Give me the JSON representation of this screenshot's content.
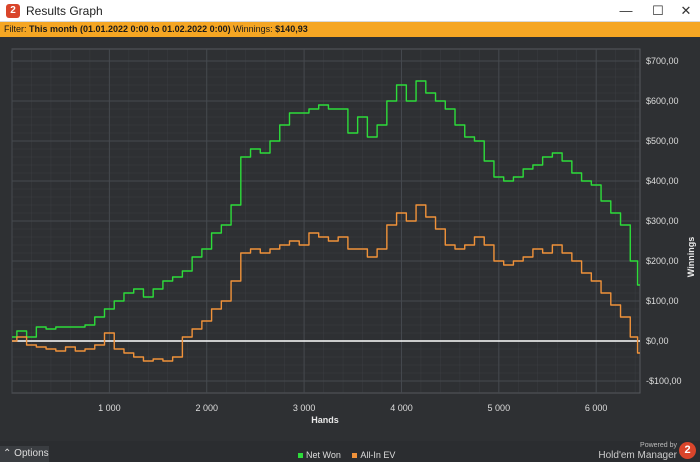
{
  "window": {
    "title": "Results Graph",
    "minimize_glyph": "—",
    "maximize_glyph": "☐",
    "close_glyph": "✕"
  },
  "filter": {
    "label": "Filter:",
    "value": "This month (01.01.2022 0:00 to 01.02.2022 0:00)",
    "winnings_label": "Winnings:",
    "winnings_value": "$140,93"
  },
  "footer": {
    "options_label": "Options",
    "powered_by": "Powered by",
    "product": "Hold'em Manager",
    "logo_text": "2"
  },
  "colors": {
    "background": "#2e3033",
    "net_won": "#2ddc3a",
    "all_in_ev": "#f0923a",
    "zero_line": "#ffffff",
    "grid": "#464a4f"
  },
  "chart_data": {
    "type": "line",
    "xlabel": "Hands",
    "ylabel": "Winnings",
    "xlim": [
      0,
      6450
    ],
    "ylim": [
      -130,
      730
    ],
    "x_ticks": [
      1000,
      2000,
      3000,
      4000,
      5000,
      6000
    ],
    "x_tick_labels": [
      "1 000",
      "2 000",
      "3 000",
      "4 000",
      "5 000",
      "6 000"
    ],
    "y_ticks": [
      -100,
      0,
      100,
      200,
      300,
      400,
      500,
      600,
      700
    ],
    "y_tick_labels": [
      "-$100,00",
      "$0,00",
      "$100,00",
      "$200,00",
      "$300,00",
      "$400,00",
      "$500,00",
      "$600,00",
      "$700,00"
    ],
    "grid": true,
    "legend_position": "bottom-center",
    "series": [
      {
        "name": "Net Won",
        "x": [
          0,
          100,
          200,
          300,
          400,
          500,
          600,
          700,
          800,
          900,
          1000,
          1100,
          1200,
          1300,
          1400,
          1500,
          1600,
          1700,
          1800,
          1900,
          2000,
          2100,
          2200,
          2300,
          2400,
          2500,
          2600,
          2700,
          2800,
          2900,
          3000,
          3100,
          3200,
          3300,
          3400,
          3500,
          3600,
          3700,
          3800,
          3900,
          4000,
          4100,
          4200,
          4300,
          4400,
          4500,
          4600,
          4700,
          4800,
          4900,
          5000,
          5100,
          5200,
          5300,
          5400,
          5500,
          5600,
          5700,
          5800,
          5900,
          6000,
          6100,
          6200,
          6300,
          6400,
          6450
        ],
        "values": [
          10,
          25,
          10,
          35,
          30,
          35,
          35,
          35,
          40,
          60,
          80,
          100,
          120,
          130,
          110,
          130,
          150,
          160,
          175,
          210,
          230,
          270,
          290,
          340,
          460,
          480,
          470,
          500,
          540,
          570,
          570,
          580,
          590,
          580,
          580,
          520,
          560,
          510,
          540,
          600,
          640,
          600,
          650,
          620,
          600,
          580,
          540,
          510,
          500,
          450,
          410,
          400,
          410,
          430,
          440,
          460,
          470,
          450,
          420,
          400,
          390,
          350,
          320,
          290,
          200,
          140
        ]
      },
      {
        "name": "All-In EV",
        "x": [
          0,
          100,
          200,
          300,
          400,
          500,
          600,
          700,
          800,
          900,
          1000,
          1100,
          1200,
          1300,
          1400,
          1500,
          1600,
          1700,
          1800,
          1900,
          2000,
          2100,
          2200,
          2300,
          2400,
          2500,
          2600,
          2700,
          2800,
          2900,
          3000,
          3100,
          3200,
          3300,
          3400,
          3500,
          3600,
          3700,
          3800,
          3900,
          4000,
          4100,
          4200,
          4300,
          4400,
          4500,
          4600,
          4700,
          4800,
          4900,
          5000,
          5100,
          5200,
          5300,
          5400,
          5500,
          5600,
          5700,
          5800,
          5900,
          6000,
          6100,
          6200,
          6300,
          6400,
          6450
        ],
        "values": [
          0,
          10,
          -10,
          -15,
          -20,
          -25,
          -15,
          -25,
          -20,
          -10,
          20,
          -20,
          -30,
          -40,
          -50,
          -45,
          -50,
          -40,
          10,
          30,
          50,
          80,
          100,
          150,
          220,
          230,
          220,
          230,
          240,
          250,
          240,
          270,
          260,
          250,
          260,
          230,
          230,
          210,
          230,
          290,
          320,
          300,
          340,
          310,
          280,
          240,
          230,
          240,
          260,
          240,
          200,
          190,
          200,
          210,
          230,
          220,
          240,
          220,
          200,
          170,
          150,
          120,
          90,
          60,
          10,
          -30
        ]
      }
    ]
  }
}
